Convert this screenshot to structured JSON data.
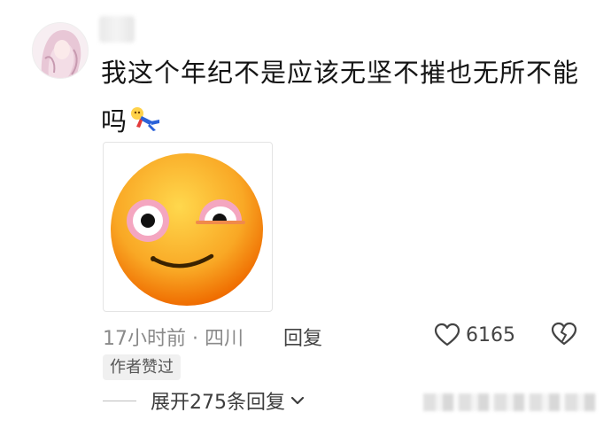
{
  "comment": {
    "text": "我这个年纪不是应该无坚不摧也无所不能吗"
  },
  "meta": {
    "time_location": "17小时前 · 四川",
    "reply_label": "回复",
    "like_count": "6165"
  },
  "badge": {
    "label": "作者赞过"
  },
  "expand": {
    "label": "展开275条回复"
  },
  "icons": {
    "like": "heart-outline-icon",
    "dislike": "broken-heart-icon",
    "expand": "chevron-down-icon"
  }
}
